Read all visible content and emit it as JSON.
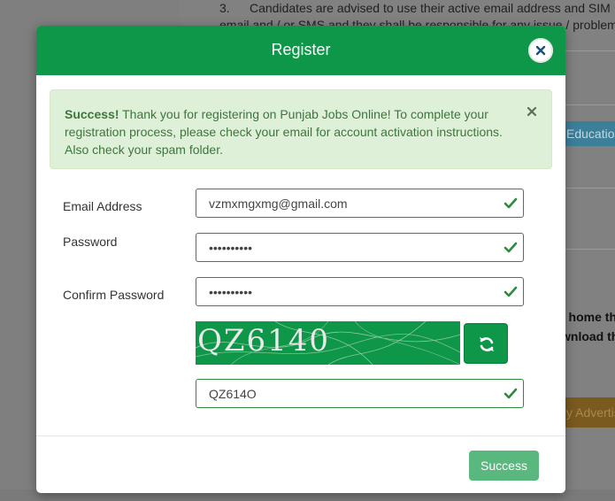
{
  "background": {
    "notice_number": "3.",
    "notice_line1": "Candidates are advised to use their active email address and SIM",
    "notice_line2": "email and / or SMS and they shall be responsible for any issue / problem",
    "education_label": "Educatio",
    "bold_line1": "t home th",
    "bold_line2": "wnload th",
    "advert_label": "y Advertis"
  },
  "modal": {
    "title": "Register",
    "alert": {
      "strong": "Success!",
      "message": " Thank you for registering on Punjab Jobs Online! To complete your registration process, please check your email for account activation instructions. Also check your spam folder."
    },
    "form": {
      "email_label": "Email Address",
      "email_value": "vzmxmgxmg@gmail.com",
      "password_label": "Password",
      "password_value": "••••••••••",
      "confirm_label": "Confirm Password",
      "confirm_value": "••••••••••",
      "captcha_text": "QZ6140",
      "captcha_value": "QZ614O"
    },
    "submit_label": "Success"
  },
  "colors": {
    "brand_green": "#0e9748",
    "success_bg": "#dff0d8",
    "success_text": "#3c763d",
    "button_disabled": "#5ab77e"
  },
  "icons": {
    "close": "close-icon",
    "alert_close": "close-icon",
    "field_valid": "checkmark-icon",
    "refresh": "refresh-icon"
  }
}
